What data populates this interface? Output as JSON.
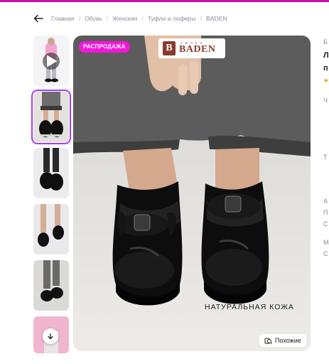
{
  "breadcrumbs": [
    "Главная",
    "Обувь",
    "Женская",
    "Туфли и лоферы",
    "BADEN"
  ],
  "sale_badge": "РАСПРОДАЖА",
  "logo": {
    "mark": "B",
    "small": "SHOES",
    "brand": "BADEN"
  },
  "caption": "НАТУРАЛЬНАЯ КОЖА",
  "similar_label": "Похожие",
  "right_panel_fragments": [
    "Б",
    "Л",
    "п",
    "★",
    "Ч",
    "Т",
    "А",
    "П",
    "С",
    "М",
    "С"
  ],
  "colors": {
    "accent": "#a73afd",
    "sale": "#f615da",
    "topbar": "#cb11ab"
  },
  "icons": [
    "back-arrow-icon",
    "play-icon",
    "scroll-down-icon",
    "similar-icon"
  ]
}
